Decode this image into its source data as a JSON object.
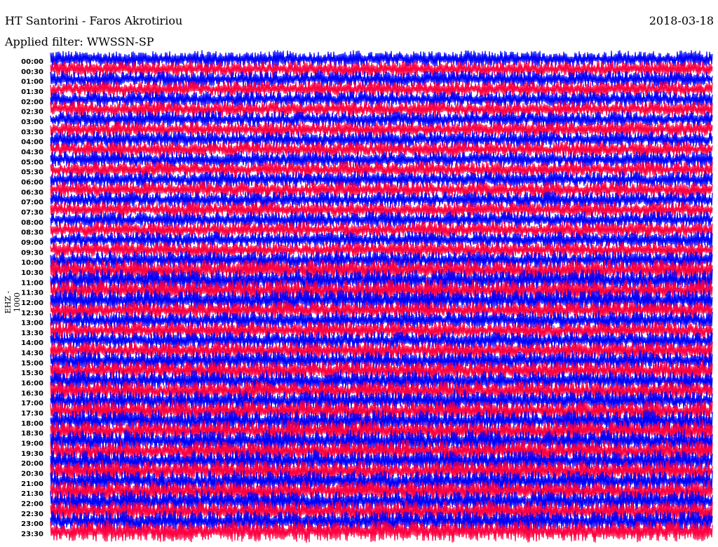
{
  "header": {
    "station": "HT Santorini - Faros Akrotiriou",
    "date": "2018-03-18",
    "filter": "Applied filter: WWSSN-SP"
  },
  "chart_data": {
    "type": "line",
    "title": "HT Santorini - Faros Akrotiriou",
    "ylabel": "EHZ - 1000",
    "xlabel": "",
    "trace_duration_minutes": 30,
    "colors": [
      "#0000ff",
      "#ff0040"
    ],
    "tick_labels": [
      "00:00",
      "00:30",
      "01:00",
      "01:30",
      "02:00",
      "02:30",
      "03:00",
      "03:30",
      "04:00",
      "04:30",
      "05:00",
      "05:30",
      "06:00",
      "06:30",
      "07:00",
      "07:30",
      "08:00",
      "08:30",
      "09:00",
      "09:30",
      "10:00",
      "10:30",
      "11:00",
      "11:30",
      "12:00",
      "12:30",
      "13:00",
      "13:30",
      "14:00",
      "14:30",
      "15:00",
      "15:30",
      "16:00",
      "16:30",
      "17:00",
      "17:30",
      "18:00",
      "18:30",
      "19:00",
      "19:30",
      "20:00",
      "20:30",
      "21:00",
      "21:30",
      "22:00",
      "22:30",
      "23:00",
      "23:30"
    ],
    "relative_amplitude": [
      1.0,
      1.0,
      1.0,
      1.0,
      1.0,
      1.0,
      1.0,
      1.0,
      1.0,
      1.0,
      1.0,
      1.0,
      1.0,
      1.0,
      1.0,
      1.0,
      1.0,
      1.0,
      1.0,
      1.0,
      1.1,
      1.3,
      1.3,
      1.3,
      1.3,
      1.1,
      1.1,
      1.1,
      1.1,
      1.15,
      1.15,
      1.2,
      1.2,
      1.2,
      1.25,
      1.25,
      1.3,
      1.3,
      1.3,
      1.3,
      1.3,
      1.3,
      1.3,
      1.3,
      1.3,
      1.3,
      1.3,
      1.3
    ]
  }
}
